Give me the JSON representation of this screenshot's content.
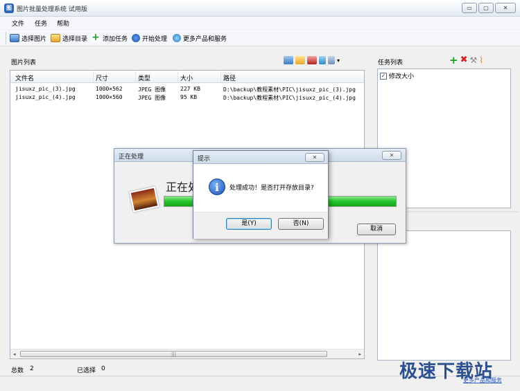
{
  "window": {
    "title": "图片批量处理系统 试用版",
    "icon_letter": "图"
  },
  "menu": [
    "文件",
    "任务",
    "帮助"
  ],
  "toolbar": {
    "select_image": "选择图片",
    "select_dir": "选择目录",
    "add_task": "添加任务",
    "start": "开始处理",
    "more": "更多产品和服务"
  },
  "image_list": {
    "label": "图片列表",
    "columns": [
      "文件名",
      "尺寸",
      "类型",
      "大小",
      "路径"
    ],
    "rows": [
      {
        "name": "jisuxz_pic_(3).jpg",
        "size": "1000×562",
        "type": "JPEG 图像",
        "filesize": "227 KB",
        "path": "D:\\backup\\教程素材\\PIC\\jisuxz_pic_(3).jpg"
      },
      {
        "name": "jisuxz_pic_(4).jpg",
        "size": "1000×560",
        "type": "JPEG 图像",
        "filesize": "95 KB",
        "path": "D:\\backup\\教程素材\\PIC\\jisuxz_pic_(4).jpg"
      }
    ]
  },
  "task_list": {
    "label": "任务列表",
    "items": [
      {
        "label": "修改大小",
        "checked": true
      }
    ]
  },
  "status": {
    "total_label": "总数",
    "total_value": "2",
    "selected_label": "已选择",
    "selected_value": "0"
  },
  "watermark": {
    "big": "极速下载站",
    "small": "更多产品和服务"
  },
  "progress_dialog": {
    "title": "正在处理",
    "text": "正在处",
    "progress": 1.0,
    "cancel": "取消"
  },
  "message_dialog": {
    "title": "提示",
    "message": "处理成功！是否打开存放目录?",
    "yes": "是(Y)",
    "no": "否(N)"
  },
  "glyphs": {
    "minimize": "▭",
    "restore": "▢",
    "close": "✕",
    "check": "✓",
    "info": "i",
    "scroll_left": "◂",
    "scroll_right": "▸",
    "grip": "|||",
    "dropdown": "▾"
  }
}
